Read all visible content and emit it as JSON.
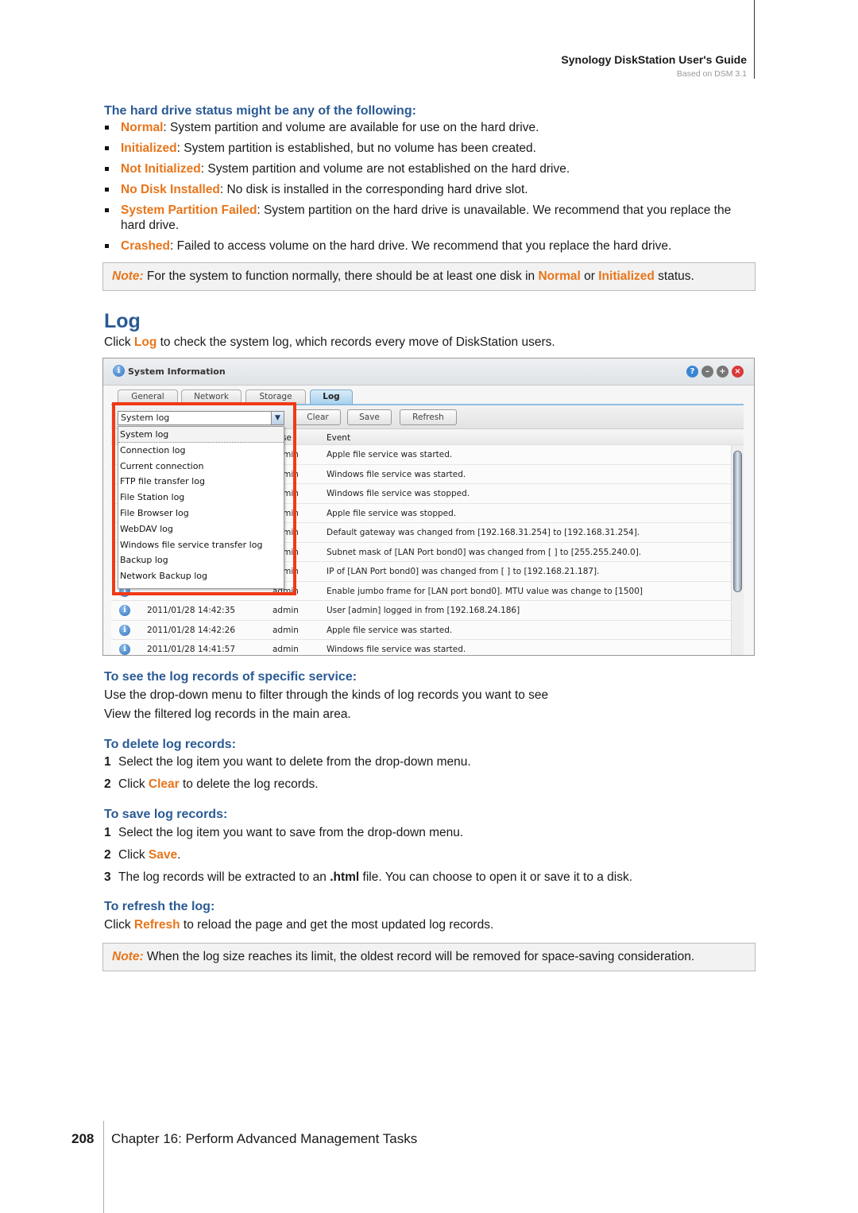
{
  "header": {
    "title": "Synology DiskStation User's Guide",
    "subtitle": "Based on DSM 3.1"
  },
  "status": {
    "heading": "The hard drive status might be any of the following:",
    "items": [
      {
        "term": "Normal",
        "desc": ": System partition and volume are available for use on the hard drive."
      },
      {
        "term": "Initialized",
        "desc": ": System partition is established, but no volume has been created."
      },
      {
        "term": "Not Initialized",
        "desc": ": System partition and volume are not established on the hard drive."
      },
      {
        "term": "No Disk Installed",
        "desc": ": No disk is installed in the corresponding hard drive slot."
      },
      {
        "term": "System Partition Failed",
        "desc": ": System partition on the hard drive is unavailable. We recommend that you replace the hard drive."
      },
      {
        "term": "Crashed",
        "desc": ": Failed to access volume on the hard drive. We recommend that you replace the hard drive."
      }
    ],
    "note": {
      "label": "Note:",
      "t1": " For the system to function normally, there should be at least one disk in ",
      "k1": "Normal",
      "t2": " or ",
      "k2": "Initialized",
      "t3": " status."
    }
  },
  "log": {
    "title": "Log",
    "intro_pre": "Click ",
    "intro_link": "Log",
    "intro_post": " to check the system log, which records every move of DiskStation users."
  },
  "window": {
    "title": "System Information",
    "tabs": [
      "General",
      "Network",
      "Storage",
      "Log"
    ],
    "active_tab": "Log",
    "buttons": {
      "clear": "Clear",
      "save": "Save",
      "refresh": "Refresh"
    },
    "dropdown": {
      "selected": "System log",
      "options": [
        "System log",
        "Connection log",
        "Current connection",
        "FTP file transfer log",
        "File Station log",
        "File Browser log",
        "WebDAV log",
        "Windows file service transfer log",
        "Backup log",
        "Network Backup log"
      ]
    },
    "columns": {
      "user": "se",
      "event": "Event"
    },
    "rows": [
      {
        "time": "",
        "user": "admin",
        "event": "Apple file service was started."
      },
      {
        "time": "",
        "user": "admin",
        "event": "Windows file service was started."
      },
      {
        "time": "",
        "user": "admin",
        "event": "Windows file service was stopped."
      },
      {
        "time": "",
        "user": "admin",
        "event": "Apple file service was stopped."
      },
      {
        "time": "",
        "user": "admin",
        "event": "Default gateway was changed from [192.168.31.254] to [192.168.31.254]."
      },
      {
        "time": "",
        "user": "admin",
        "event": "Subnet mask of [LAN Port bond0] was changed from [ ] to [255.255.240.0]."
      },
      {
        "time": "",
        "user": "admin",
        "event": "IP of [LAN Port bond0] was changed from [ ] to [192.168.21.187]."
      },
      {
        "time": "",
        "user": "admin",
        "event": "Enable jumbo frame for [LAN port bond0]. MTU value was change to [1500]"
      },
      {
        "time": "2011/01/28 14:42:35",
        "user": "admin",
        "event": "User [admin] logged in from [192.168.24.186]"
      },
      {
        "time": "2011/01/28 14:42:26",
        "user": "admin",
        "event": "Apple file service was started."
      },
      {
        "time": "2011/01/28 14:41:57",
        "user": "admin",
        "event": "Windows file service was started."
      }
    ]
  },
  "specific": {
    "heading": "To see the log records of specific service:",
    "l1": "Use the drop-down menu to filter through the kinds of log records you want to see",
    "l2": "View the filtered log records in the main area."
  },
  "delete": {
    "heading": "To delete log records:",
    "s1": "Select the log item you want to delete from the drop-down menu.",
    "s2_pre": "Click ",
    "s2_link": "Clear",
    "s2_post": " to delete the log records."
  },
  "save": {
    "heading": "To save log records:",
    "s1": "Select the log item you want to save from the drop-down menu.",
    "s2_pre": "Click ",
    "s2_link": "Save",
    "s2_post": ".",
    "s3_pre": "The log records will be extracted to an ",
    "s3_bold": ".html",
    "s3_post": " file. You can choose to open it or save it to a disk."
  },
  "refresh": {
    "heading": "To refresh the log:",
    "pre": "Click ",
    "link": "Refresh",
    "post": " to reload the page and get the most updated log records."
  },
  "note2": {
    "label": "Note:",
    "text": " When the log size reaches its limit, the oldest record will be removed for space-saving consideration."
  },
  "footer": {
    "page": "208",
    "chapter": "Chapter 16: Perform Advanced Management Tasks"
  },
  "colors": {
    "heading": "#2a5a94",
    "accent": "#e8751a",
    "highlight_box": "#f03a17"
  }
}
